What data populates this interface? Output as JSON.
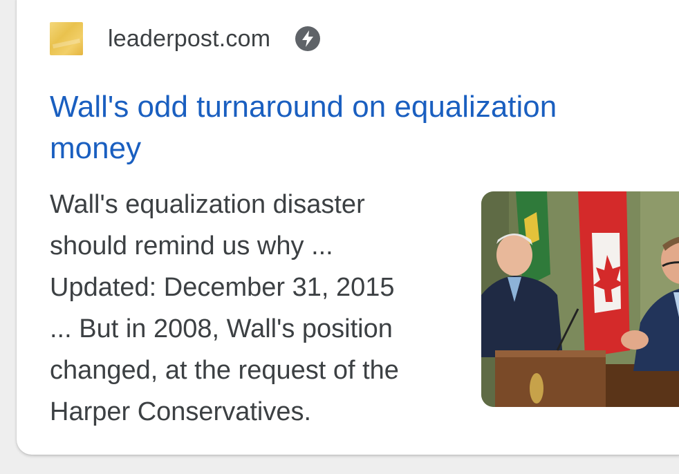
{
  "result": {
    "source": "leaderpost.com",
    "title": "Wall's odd turnaround on equalization money",
    "snippet_lines": [
      "Wall's equalization disaster",
      "should remind us why ...",
      "Updated: December 31, 2015",
      "... But in 2008, Wall's position",
      "changed, at the request of the",
      "Harper Conservatives."
    ],
    "source_icon": "leaderpost-favicon",
    "amp_icon": "lightning-bolt-icon",
    "thumbnail": "news-photo-thumbnail"
  },
  "colors": {
    "title": "#1a5fc0",
    "text": "#3c4043",
    "amp_badge": "#5f6368"
  }
}
